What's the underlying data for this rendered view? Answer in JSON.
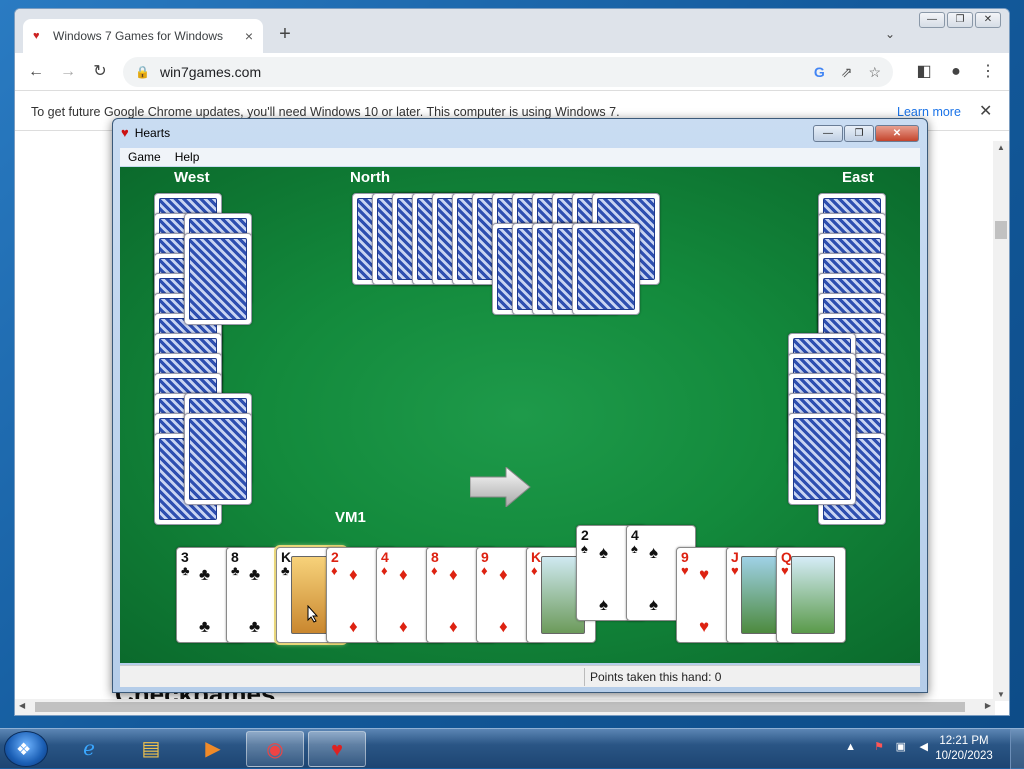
{
  "browser": {
    "tab_title": "Windows 7 Games for Windows",
    "tab_close": "×",
    "new_tab": "+",
    "url": "win7games.com",
    "infobar_text": "To get future Google Chrome updates, you'll need Windows 10 or later. This computer is using Windows 7.",
    "infobar_link": "Learn more",
    "infobar_close": "✕",
    "page_heading_partial": "Checkbames"
  },
  "hearts": {
    "title": "Hearts",
    "menu": [
      "Game",
      "Help"
    ],
    "players": {
      "west": "West",
      "north": "North",
      "east": "East",
      "south": "VM1"
    },
    "status": "Points taken this hand: 0",
    "hand": [
      {
        "rank": "3",
        "suit": "♣",
        "color": "black"
      },
      {
        "rank": "8",
        "suit": "♣",
        "color": "black"
      },
      {
        "rank": "K",
        "suit": "♣",
        "color": "black",
        "face": true
      },
      {
        "rank": "2",
        "suit": "♦",
        "color": "red"
      },
      {
        "rank": "4",
        "suit": "♦",
        "color": "red"
      },
      {
        "rank": "8",
        "suit": "♦",
        "color": "red"
      },
      {
        "rank": "9",
        "suit": "♦",
        "color": "red"
      },
      {
        "rank": "K",
        "suit": "♦",
        "color": "red",
        "face": true
      },
      {
        "rank": "2",
        "suit": "♠",
        "color": "black"
      },
      {
        "rank": "4",
        "suit": "♠",
        "color": "black"
      },
      {
        "rank": "9",
        "suit": "♥",
        "color": "red"
      },
      {
        "rank": "J",
        "suit": "♥",
        "color": "red",
        "face": true
      },
      {
        "rank": "Q",
        "suit": "♥",
        "color": "red",
        "face": true
      }
    ]
  },
  "taskbar": {
    "time": "12:21 PM",
    "date": "10/20/2023"
  },
  "colors": {
    "felt": "#138a3c",
    "card_back": "#2e4fb0",
    "red_suit": "#d21",
    "accent_link": "#1a73e8"
  }
}
